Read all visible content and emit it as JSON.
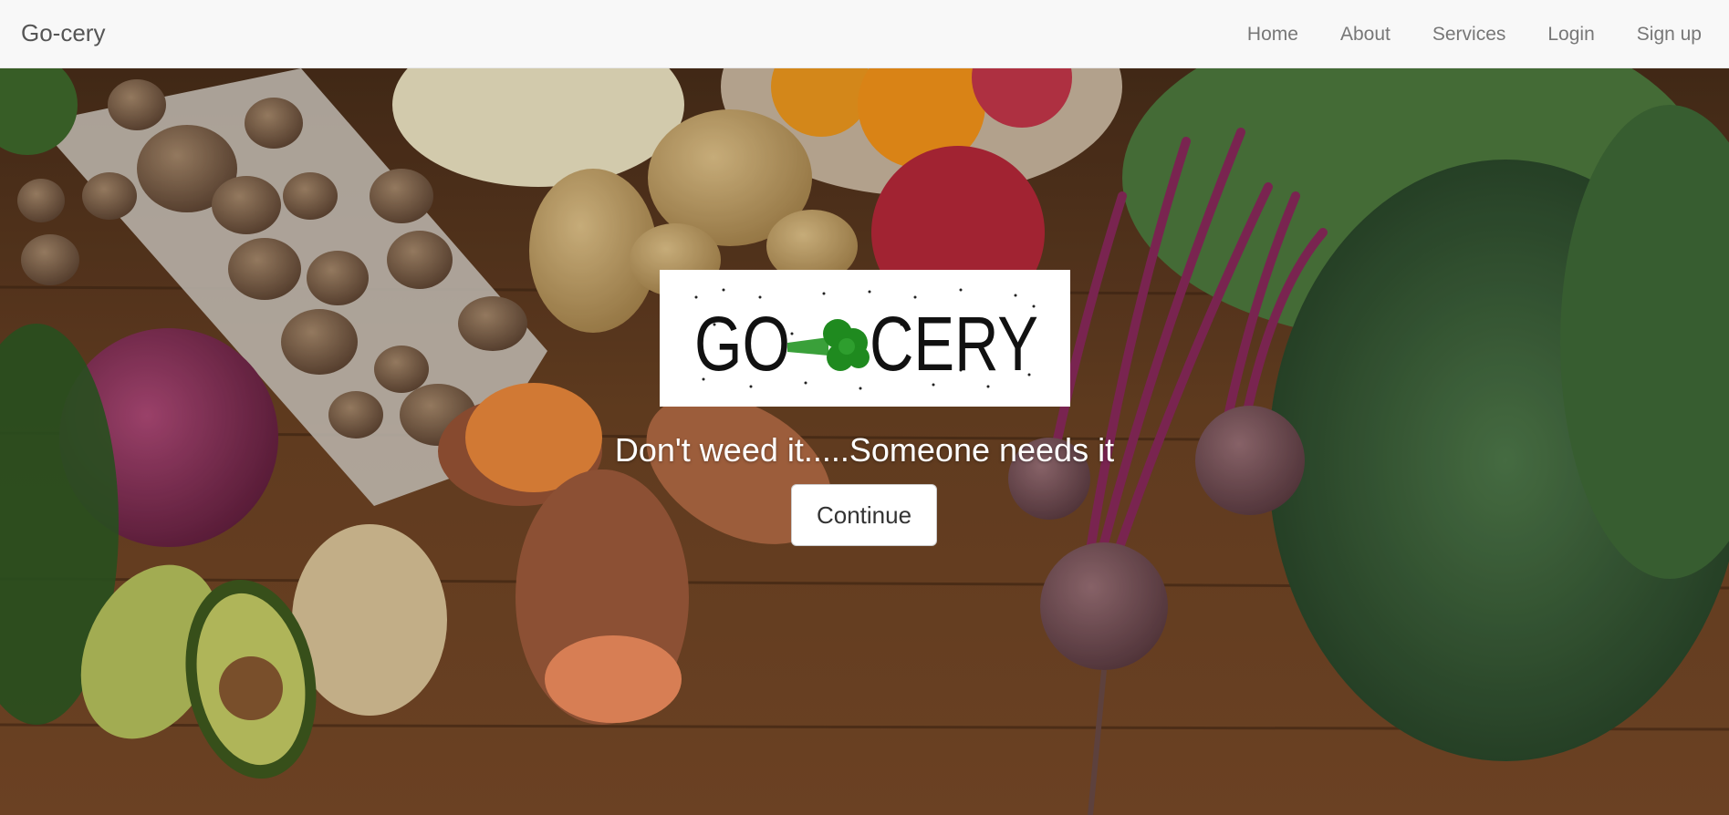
{
  "navbar": {
    "brand": "Go-cery",
    "links": [
      "Home",
      "About",
      "Services",
      "Login",
      "Sign up"
    ]
  },
  "hero": {
    "logo_text": "GO",
    "logo_text_2": "CERY",
    "tagline": "Don't weed it.....Someone needs it",
    "button_label": "Continue"
  },
  "colors": {
    "navbar_bg": "#f8f8f8",
    "nav_text": "#777777",
    "brand_text": "#555555",
    "wood": "#6b4326",
    "logo_green": "#2e8b2e"
  }
}
